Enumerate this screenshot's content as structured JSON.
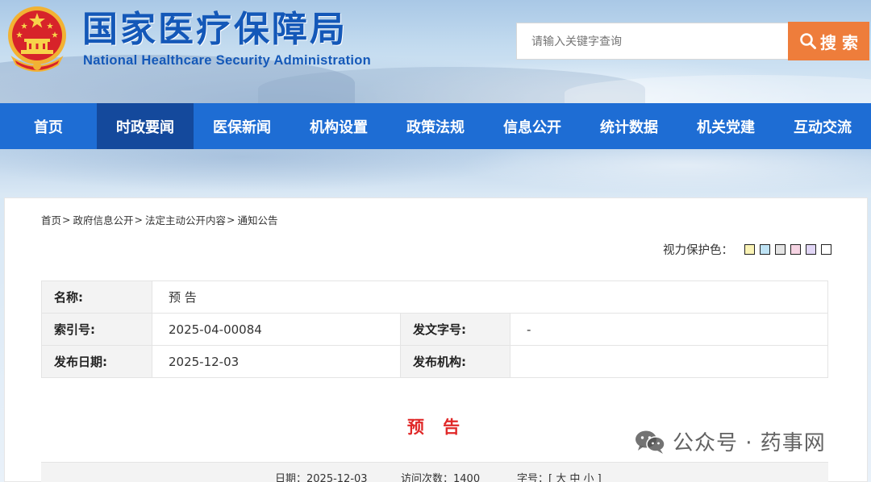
{
  "header": {
    "title": "国家医疗保障局",
    "subtitle": "National Healthcare Security Administration",
    "search_placeholder": "请输入关键字查询",
    "search_button": "搜 索"
  },
  "nav": {
    "items": [
      {
        "label": "首页"
      },
      {
        "label": "时政要闻"
      },
      {
        "label": "医保新闻"
      },
      {
        "label": "机构设置"
      },
      {
        "label": "政策法规"
      },
      {
        "label": "信息公开"
      },
      {
        "label": "统计数据"
      },
      {
        "label": "机关党建"
      },
      {
        "label": "互动交流"
      }
    ],
    "active_index": 1
  },
  "breadcrumb": {
    "items": [
      "首页",
      "政府信息公开",
      "法定主动公开内容",
      "通知公告"
    ],
    "separator": ">"
  },
  "eye_protection": {
    "label": "视力保护色：",
    "colors": [
      "#faf3b5",
      "#bfe3f5",
      "#e4e4e4",
      "#f6d4e3",
      "#e1d6f6",
      "#ffffff"
    ]
  },
  "info": {
    "name_label": "名称:",
    "name_value": "预 告",
    "index_label": "索引号:",
    "index_value": "2025-04-00084",
    "doc_no_label": "发文字号:",
    "doc_no_value": "-",
    "date_label": "发布日期:",
    "date_value": "2025-12-03",
    "org_label": "发布机构:",
    "org_value": ""
  },
  "article": {
    "title": "预 告"
  },
  "meta": {
    "date": "日期：2025-12-03",
    "visits": "访问次数：1400",
    "font_size": "字号：[ 大 中 小 ]"
  },
  "watermark": {
    "text": "公众号 · 药事网"
  },
  "colors": {
    "brand_blue": "#1e6dd4",
    "nav_active": "#14499c",
    "title_blue": "#1458b8",
    "search_orange": "#ee7d3b",
    "article_title_red": "#e02828"
  }
}
